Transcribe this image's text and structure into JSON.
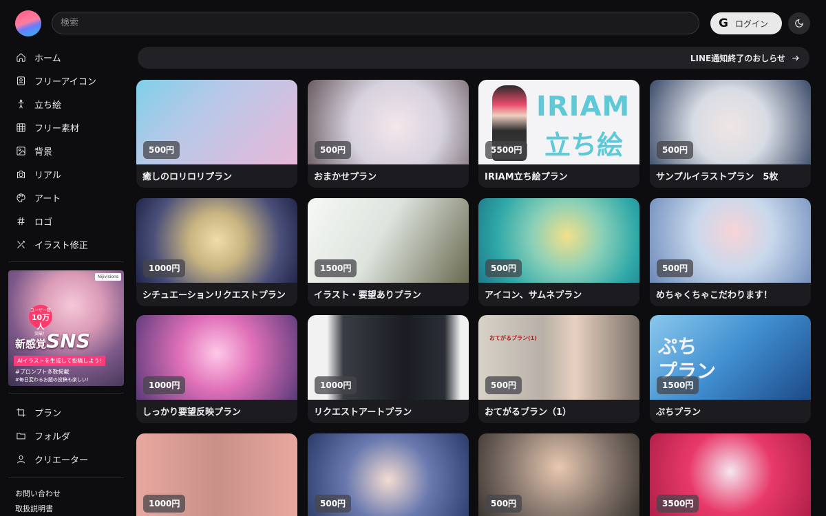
{
  "header": {
    "search_placeholder": "検索",
    "login_label": "ログイン",
    "theme_toggle": "moon-icon"
  },
  "sidebar": {
    "items": [
      {
        "label": "ホーム",
        "icon": "home-icon"
      },
      {
        "label": "フリーアイコン",
        "icon": "portrait-icon"
      },
      {
        "label": "立ち絵",
        "icon": "person-standing-icon"
      },
      {
        "label": "フリー素材",
        "icon": "grid-icon"
      },
      {
        "label": "背景",
        "icon": "image-icon"
      },
      {
        "label": "リアル",
        "icon": "camera-icon"
      },
      {
        "label": "アート",
        "icon": "palette-icon"
      },
      {
        "label": "ロゴ",
        "icon": "hash-icon"
      },
      {
        "label": "イラスト修正",
        "icon": "tools-icon"
      }
    ],
    "banner": {
      "tag": "Nijivisions",
      "badge_top": "ユーザー数",
      "badge_num": "10万人",
      "badge_bottom": "突破！",
      "title_prefix": "新感覚",
      "title_main": "SNS",
      "subtitle": "AIイラストを生成して投稿しよう!",
      "line1": "#プロンプト多数掲載",
      "line2": "#毎日変わるお題の投稿も楽しい!"
    },
    "secondary_items": [
      {
        "label": "プラン",
        "icon": "crop-icon"
      },
      {
        "label": "フォルダ",
        "icon": "folder-icon"
      },
      {
        "label": "クリエーター",
        "icon": "user-icon"
      }
    ],
    "footer_links": [
      "お問い合わせ",
      "取扱説明書"
    ]
  },
  "notice": {
    "text": "LINE通知終了のおしらせ",
    "icon": "arrow-right-icon"
  },
  "cards": [
    {
      "price": "500円",
      "title": "癒しのロリロリプラン",
      "bg": "#b9c8e8"
    },
    {
      "price": "500円",
      "title": "おまかせプラン",
      "bg": "#d6d2de"
    },
    {
      "price": "5500円",
      "title": "IRIAM立ち絵プラン",
      "bg": "#f4f4f6",
      "overlay_line1": "IRIAM",
      "overlay_line2": "立ち絵"
    },
    {
      "price": "500円",
      "title": "サンプルイラストプラン　5枚",
      "bg": "#e4e6ea"
    },
    {
      "price": "1000円",
      "title": "シチュエーションリクエストプラン",
      "bg": "#4a4f7a"
    },
    {
      "price": "1500円",
      "title": "イラスト・要望ありプラン",
      "bg": "#dde4de"
    },
    {
      "price": "500円",
      "title": "アイコン、サムネプラン",
      "bg": "#4fc8c0"
    },
    {
      "price": "500円",
      "title": "めちゃくちゃこだわります！",
      "bg": "#8faacc"
    },
    {
      "price": "1000円",
      "title": "しっかり要望反映プラン",
      "bg": "#c8509a"
    },
    {
      "price": "1000円",
      "title": "リクエストアートプラン",
      "bg": "#3a3d45"
    },
    {
      "price": "500円",
      "title": "おてがるプラン（1）",
      "bg": "#b8b0a8",
      "overlay_line1": "おてがるプラン(1)"
    },
    {
      "price": "1500円",
      "title": "ぷちプラン",
      "bg": "#3f8ed0",
      "overlay_line1": "ぷち",
      "overlay_line2": "プラン"
    },
    {
      "price": "1000円",
      "title": "",
      "bg": "#9a8c8a"
    },
    {
      "price": "500円",
      "title": "",
      "bg": "#3b4f78"
    },
    {
      "price": "500円",
      "title": "",
      "bg": "#8a7a70"
    },
    {
      "price": "3500円",
      "title": "",
      "bg": "#e83a6a"
    }
  ]
}
